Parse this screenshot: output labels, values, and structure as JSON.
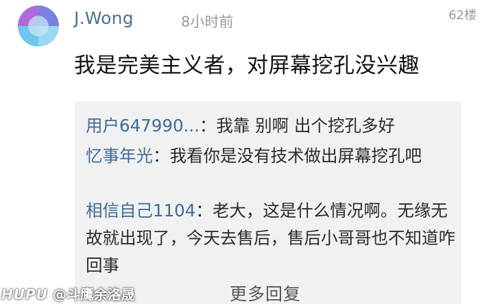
{
  "post": {
    "username": "J.Wong",
    "time": "8小时前",
    "floor": "62楼",
    "comment": "我是完美主义者，对屏幕挖孔没兴趣"
  },
  "replies": [
    {
      "author": "用户647990...",
      "sep": "：",
      "text": "我靠 别啊 出个挖孔多好"
    },
    {
      "author": "忆事年光",
      "sep": "：",
      "text": "我看你是没有技术做出屏幕挖孔吧"
    },
    {
      "author": "相信自己1104",
      "sep": "：",
      "text": "老大，这是什么情况啊。无缘无故就出现了，今天去售后，售后小哥哥也不知道咋回事"
    }
  ],
  "more_replies_label": "更多回复",
  "watermark": {
    "brand": "HUPU",
    "handle": "@斗鹰余洛晟"
  },
  "colors": {
    "username": "#4a6f9a",
    "reply_author": "#3e6a9c",
    "reply_bg": "#f1f1f1",
    "meta": "#9a9a9a"
  },
  "icons": {
    "avatar": "avatar-circle-icon"
  }
}
